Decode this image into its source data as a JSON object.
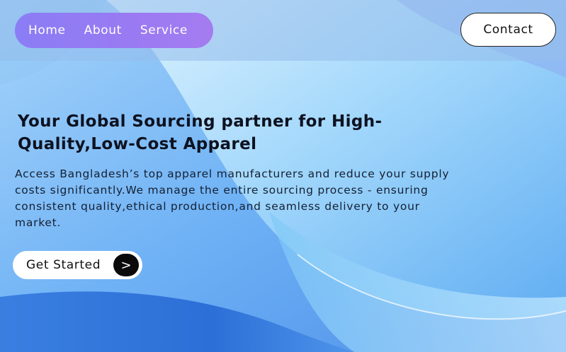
{
  "nav": {
    "items": [
      {
        "label": "Home"
      },
      {
        "label": "About"
      },
      {
        "label": "Service"
      }
    ],
    "contact_label": "Contact"
  },
  "hero": {
    "title": "Your Global Sourcing partner for High-Quality,Low-Cost Apparel",
    "description": "Access Bangladesh’s top apparel manufacturers and reduce your supply costs significantly.We manage the entire sourcing process - ensuring consistent quality,ethical production,and seamless delivery to your market.",
    "cta_label": "Get Started",
    "cta_icon": ">"
  },
  "colors": {
    "nav_pill": "#9a7af2",
    "background_light": "#d6f0ff",
    "background_deep": "#2f73d8"
  }
}
